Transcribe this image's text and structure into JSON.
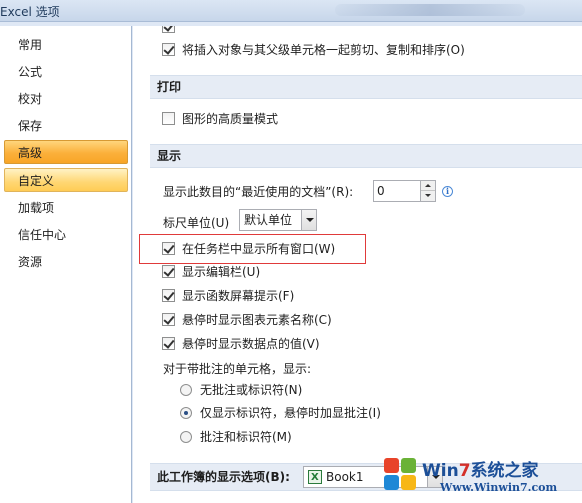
{
  "window": {
    "title": "Excel 选项"
  },
  "sidebar": {
    "items": [
      {
        "label": "常用"
      },
      {
        "label": "公式"
      },
      {
        "label": "校对"
      },
      {
        "label": "保存"
      },
      {
        "label": "高级"
      },
      {
        "label": "自定义"
      },
      {
        "label": "加载项"
      },
      {
        "label": "信任中心"
      },
      {
        "label": "资源"
      }
    ]
  },
  "top": {
    "insert_objects_label": "将插入对象与其父级单元格一起剪切、复制和排序(O)"
  },
  "print_section": {
    "header": "打印",
    "high_quality_label": "图形的高质量模式"
  },
  "display_section": {
    "header": "显示",
    "recent_docs_label": "显示此数目的“最近使用的文档”(R):",
    "recent_docs_value": "0",
    "ruler_units_label": "标尺单位(U)",
    "ruler_units_value": "默认单位",
    "show_all_windows_label": "在任务栏中显示所有窗口(W)",
    "show_formula_bar_label": "显示编辑栏(U)",
    "show_function_tips_label": "显示函数屏幕提示(F)",
    "show_chart_element_names_label": "悬停时显示图表元素名称(C)",
    "show_data_point_values_label": "悬停时显示数据点的值(V)",
    "comments_intro": "对于带批注的单元格，显示:",
    "comments_options": [
      {
        "label": "无批注或标识符(N)"
      },
      {
        "label": "仅显示标识符，悬停时加显批注(I)"
      },
      {
        "label": "批注和标识符(M)"
      }
    ]
  },
  "workbook_section": {
    "header": "此工作簿的显示选项(B):",
    "workbook_value": "Book1"
  },
  "watermark": {
    "brand_prefix": "Win",
    "brand_seven": "7",
    "brand_suffix": "系统之家",
    "url": "Www.Winwin7.com"
  },
  "colors": {
    "selected_nav": "#fbb03b",
    "section_header_bg": "#e6ecf5",
    "highlight_box": "#e03a3a"
  }
}
